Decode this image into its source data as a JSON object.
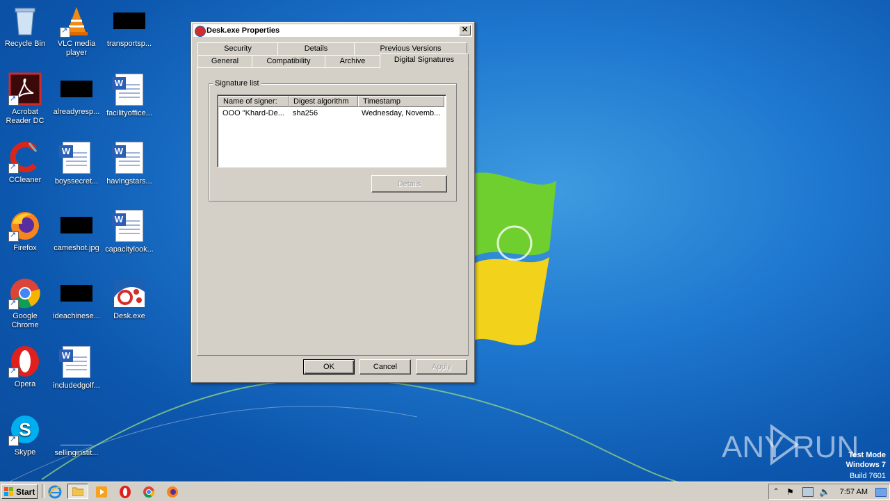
{
  "desktop": {
    "icons": [
      {
        "label": "Recycle Bin"
      },
      {
        "label": "VLC media player"
      },
      {
        "label": "transportsp..."
      },
      {
        "label": "Acrobat Reader DC"
      },
      {
        "label": "alreadyresp..."
      },
      {
        "label": "facilityoffice..."
      },
      {
        "label": "CCleaner"
      },
      {
        "label": "boyssecret..."
      },
      {
        "label": "havingstars..."
      },
      {
        "label": "Firefox"
      },
      {
        "label": "cameshot.jpg"
      },
      {
        "label": "capacitylook..."
      },
      {
        "label": "Google Chrome"
      },
      {
        "label": "ideachinese..."
      },
      {
        "label": "Desk.exe"
      },
      {
        "label": "Opera"
      },
      {
        "label": "includedgolf..."
      },
      {
        "label": "Skype"
      },
      {
        "label": "sellinginstit..."
      }
    ]
  },
  "dialog": {
    "title": "Desk.exe Properties",
    "close_label": "✕",
    "tabs_row1": [
      "Security",
      "Details",
      "Previous Versions"
    ],
    "tabs_row2": [
      "General",
      "Compatibility",
      "Archive",
      "Digital Signatures"
    ],
    "active_tab": "Digital Signatures",
    "group_label": "Signature list",
    "columns": [
      "Name of signer:",
      "Digest algorithm",
      "Timestamp"
    ],
    "rows": [
      {
        "signer": "OOO \"Khard-De...",
        "digest": "sha256",
        "timestamp": "Wednesday, Novemb..."
      }
    ],
    "details_button": "Details",
    "ok_button": "OK",
    "cancel_button": "Cancel",
    "apply_button": "Apply"
  },
  "taskbar": {
    "start_label": "Start",
    "clock": "7:57 AM"
  },
  "watermark": {
    "line1": "Test Mode",
    "line2": "Windows 7",
    "line3": "Build 7601",
    "brand": "ANY RUN"
  },
  "colors": {
    "desktop_blue": "#1f78cf",
    "dialog_gray": "#d4d0c8"
  }
}
